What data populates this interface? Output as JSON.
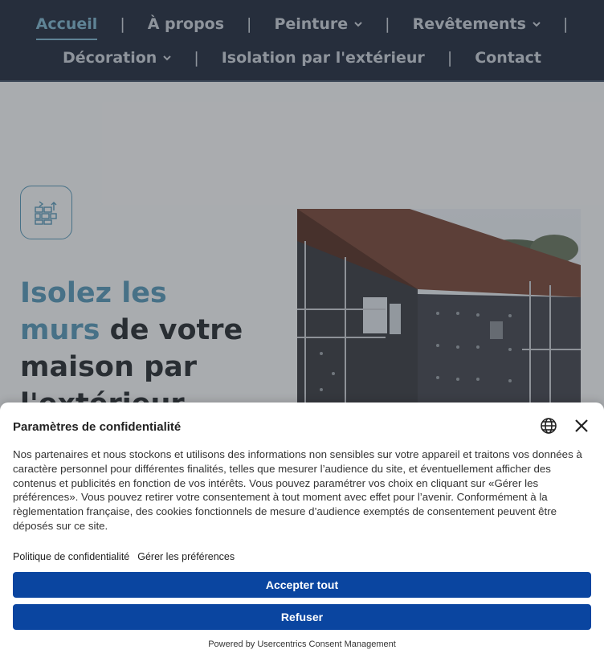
{
  "nav": {
    "row1": [
      {
        "label": "Accueil",
        "active": true,
        "dropdown": false
      },
      {
        "label": "À propos",
        "active": false,
        "dropdown": false
      },
      {
        "label": "Peinture",
        "active": false,
        "dropdown": true
      },
      {
        "label": "Revêtements",
        "active": false,
        "dropdown": true
      }
    ],
    "row2": [
      {
        "label": "Décoration",
        "dropdown": true
      },
      {
        "label": "Isolation par l'extérieur",
        "dropdown": false
      },
      {
        "label": "Contact",
        "dropdown": false
      }
    ],
    "separator": "|"
  },
  "hero": {
    "title_accent_1": "Isolez les",
    "title_accent_2": "murs",
    "title_rest_1": " de votre",
    "title_rest_2": "maison par",
    "title_rest_3": "l'extérieur"
  },
  "consent": {
    "title": "Paramètres de confidentialité",
    "body": "Nos partenaires et nous stockons et utilisons des informations non sensibles sur votre appareil et traitons vos données à caractère personnel pour différentes finalités, telles que mesurer l’audience du site, et éventuellement afficher des contenus et publicités en fonction de vos intérêts. Vous pouvez paramétrer vos choix en cliquant sur «Gérer les préférences». Vous pouvez retirer votre consentement à tout moment avec effet pour l’avenir. Conformément à la règlementation française, des cookies fonctionnels de mesure d’audience exemptés de consentement peuvent être déposés sur ce site.",
    "link_privacy": "Politique de confidentialité",
    "link_prefs": "Gérer les préférences",
    "accept_label": "Accepter tout",
    "refuse_label": "Refuser",
    "powered_by": "Powered by Usercentrics Consent Management"
  },
  "colors": {
    "nav_bg": "#273041",
    "accent": "#5a98b6",
    "button": "#0a45a0"
  }
}
